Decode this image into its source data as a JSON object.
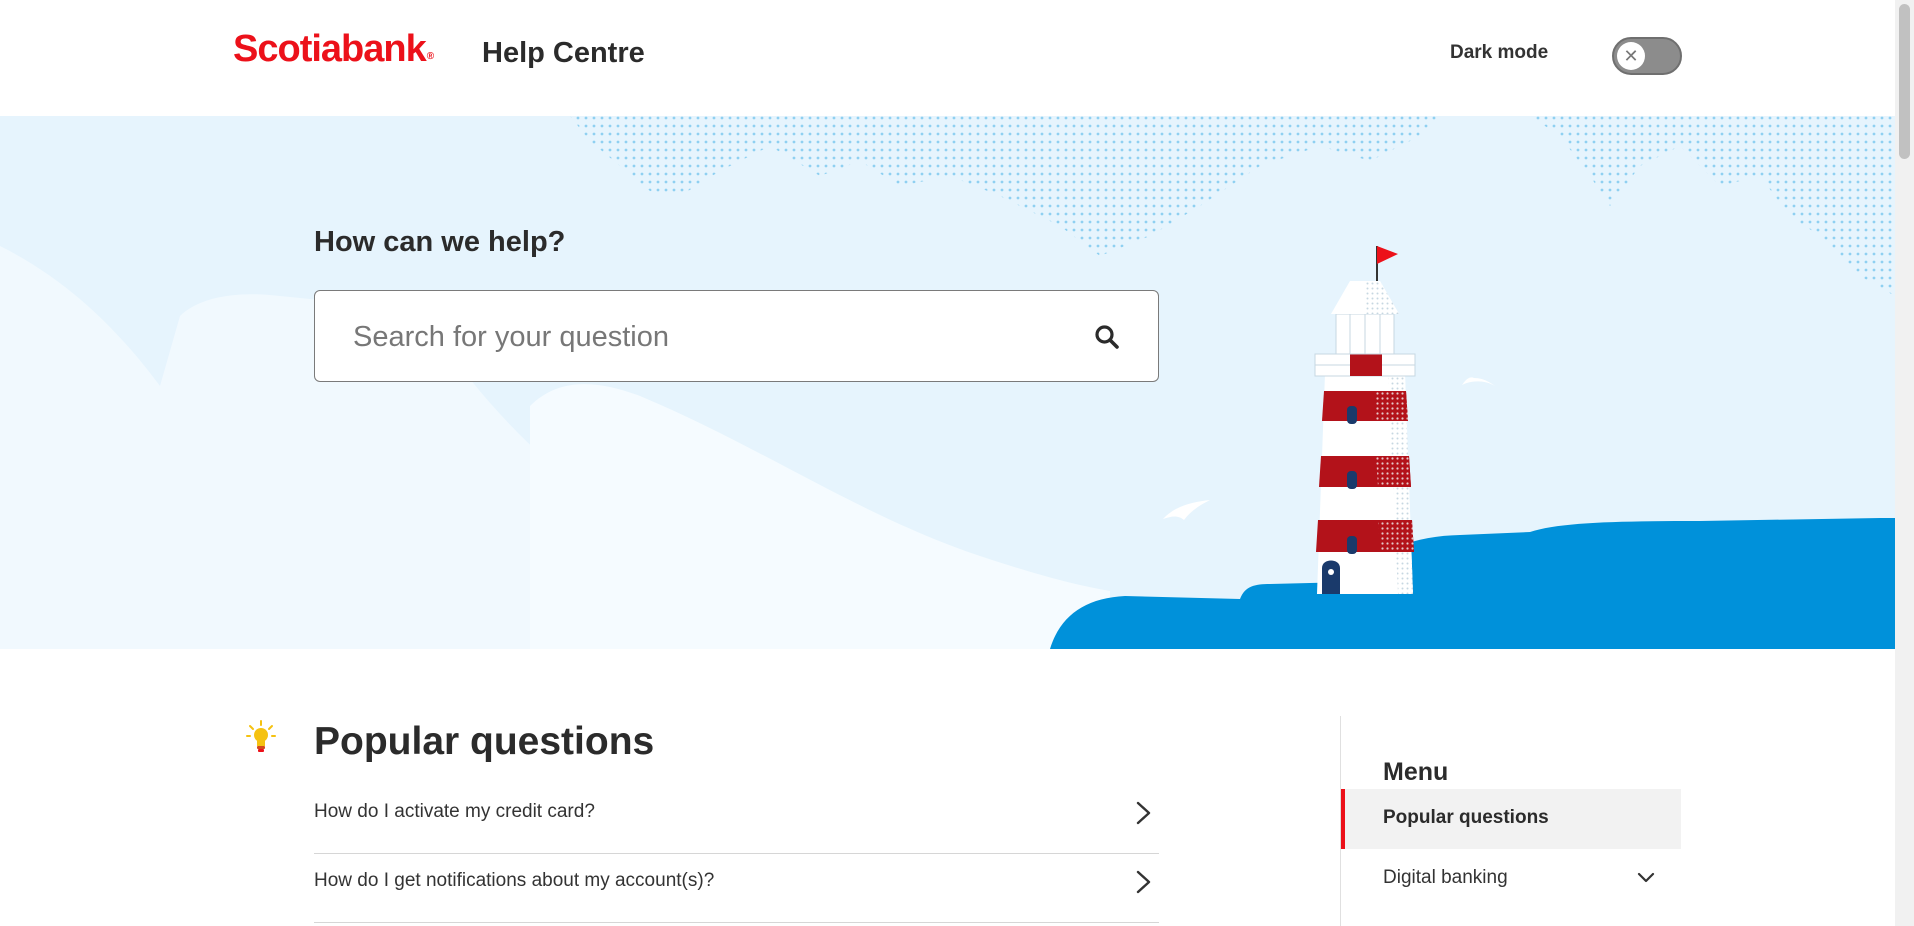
{
  "header": {
    "logo_text": "Scotiabank",
    "logo_mark": "®",
    "title": "Help Centre",
    "dark_mode_label": "Dark mode",
    "dark_mode_icon": "close-icon"
  },
  "hero": {
    "heading": "How can we help?",
    "search_placeholder": "Search for your question",
    "search_icon": "search-icon",
    "illustration": "lighthouse"
  },
  "popular": {
    "title": "Popular questions",
    "icon": "lightbulb-icon",
    "questions": [
      "How do I activate my credit card?",
      "How do I get notifications about my account(s)?"
    ]
  },
  "menu": {
    "title": "Menu",
    "items": [
      {
        "label": "Popular questions"
      },
      {
        "label": "Digital banking"
      }
    ]
  },
  "colors": {
    "brand": "#ec111a",
    "hero_background": "#e6f4fd",
    "ocean": "#0091da"
  }
}
